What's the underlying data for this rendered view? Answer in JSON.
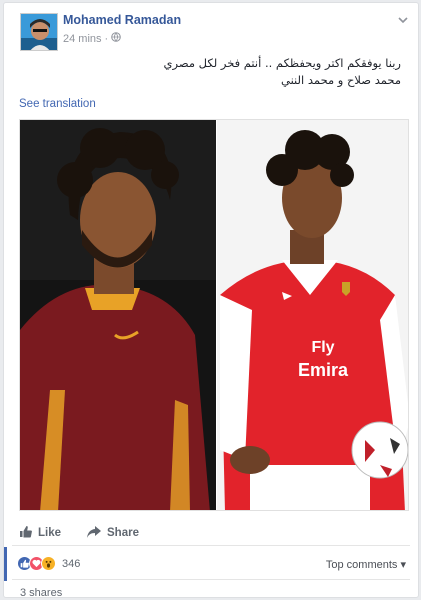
{
  "post": {
    "author": "Mohamed Ramadan",
    "time": "24 mins",
    "audience_icon": "globe-icon",
    "text_line1": "ربنا يوفقكم اكتر ويحفظكم .. أنتم فخر لكل مصري",
    "text_line2": "محمد صلاح و محمد النني",
    "see_translation": "See translation"
  },
  "actions": {
    "like": "Like",
    "share": "Share"
  },
  "reactions": {
    "icons": [
      "like-icon",
      "love-icon",
      "wow-icon"
    ],
    "count": "346",
    "sort_label": "Top comments",
    "shares": "3 shares"
  },
  "colors": {
    "link": "#365899",
    "like_blue": "#4267b2",
    "love_red": "#f25268",
    "wow_yellow": "#f7b125"
  }
}
